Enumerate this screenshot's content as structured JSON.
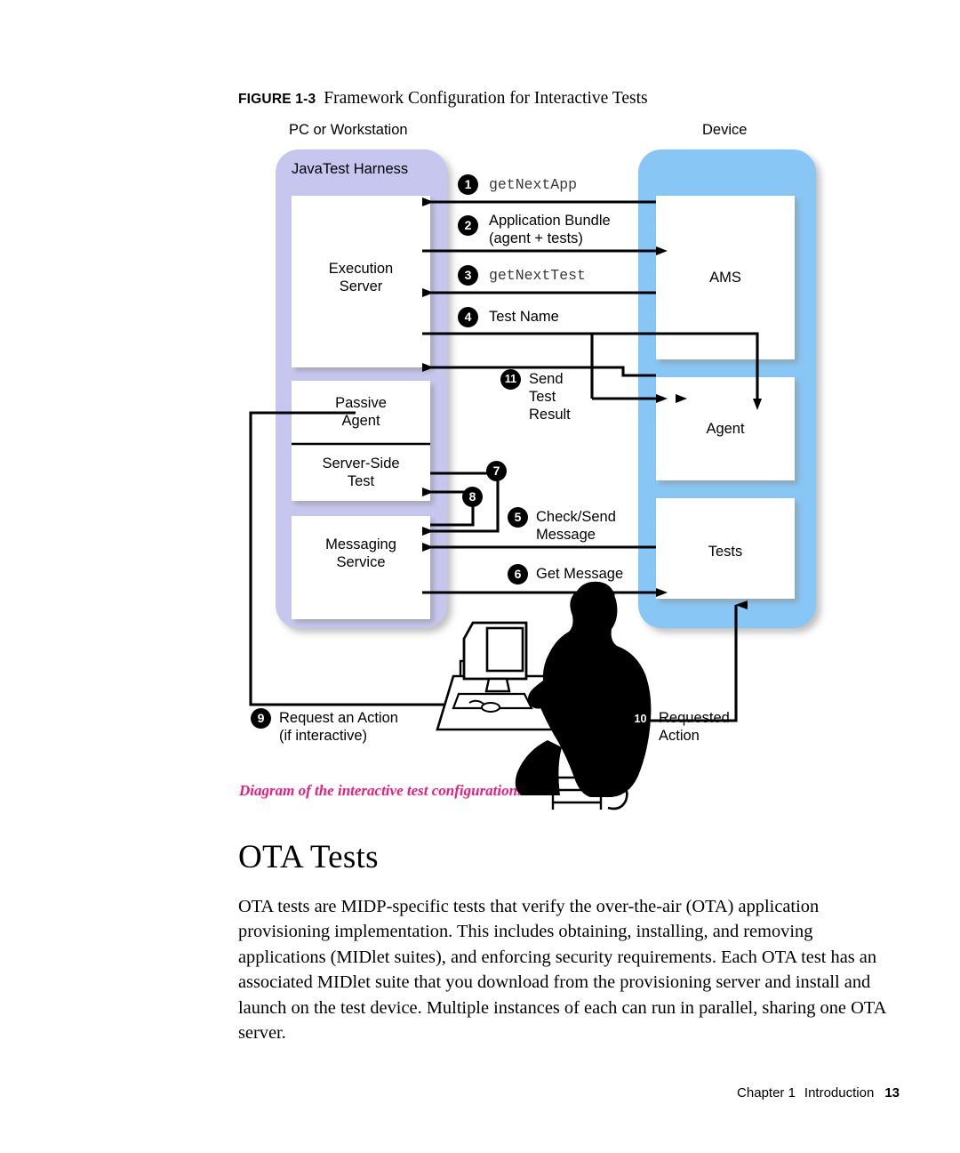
{
  "figure": {
    "label": "FIGURE 1-3",
    "title": "Framework Configuration for Interactive Tests",
    "caption": "Diagram of the interactive test configuration.",
    "caption_color": "#ec1c7d"
  },
  "diagram": {
    "left_container": {
      "outer_label": "PC or Workstation",
      "title": "JavaTest Harness",
      "fill_color": "#c6c6ef",
      "boxes": [
        {
          "id": "execution-server",
          "label_line1": "Execution",
          "label_line2": "Server"
        },
        {
          "id": "passive-agent",
          "label_line1": "Passive",
          "label_line2": "Agent"
        },
        {
          "id": "server-side-test",
          "label_line1": "Server-Side",
          "label_line2": "Test"
        },
        {
          "id": "messaging-service",
          "label_line1": "Messaging",
          "label_line2": "Service"
        }
      ]
    },
    "right_container": {
      "outer_label": "Device",
      "fill_color": "#87c6f5",
      "boxes": [
        {
          "id": "ams",
          "label": "AMS"
        },
        {
          "id": "agent",
          "label": "Agent"
        },
        {
          "id": "tests",
          "label": "Tests"
        }
      ]
    },
    "steps": [
      {
        "n": "1",
        "text_line1": "getNextApp",
        "text_line2": "",
        "mono": true
      },
      {
        "n": "2",
        "text_line1": "Application Bundle",
        "text_line2": "(agent + tests)",
        "mono": false
      },
      {
        "n": "3",
        "text_line1": "getNextTest",
        "text_line2": "",
        "mono": true
      },
      {
        "n": "4",
        "text_line1": "Test Name",
        "text_line2": "",
        "mono": false
      },
      {
        "n": "5",
        "text_line1": "Check/Send",
        "text_line2": "Message",
        "mono": false
      },
      {
        "n": "6",
        "text_line1": "Get Message",
        "text_line2": "",
        "mono": false
      },
      {
        "n": "7",
        "text_line1": "",
        "text_line2": "",
        "mono": false
      },
      {
        "n": "8",
        "text_line1": "",
        "text_line2": "",
        "mono": false
      },
      {
        "n": "9",
        "text_line1": "Request an Action",
        "text_line2": "(if interactive)",
        "mono": false
      },
      {
        "n": "10",
        "text_line1": "Requested",
        "text_line2": "Action",
        "mono": false
      },
      {
        "n": "11",
        "text_line1": "Send",
        "text_line2": "Test",
        "text_line3": "Result",
        "mono": false
      }
    ],
    "illustration": "person-at-computer-silhouette"
  },
  "content": {
    "heading": "OTA Tests",
    "paragraph": "OTA tests are MIDP-specific tests that verify the over-the-air (OTA) application provisioning implementation. This includes obtaining, installing, and removing applications (MIDlet suites), and enforcing security requirements. Each OTA test has an associated MIDlet suite that you download from the provisioning server and install and launch on the test device. Multiple instances of each can run in parallel, sharing one OTA server."
  },
  "footer": {
    "chapter": "Chapter 1",
    "section": "Introduction",
    "page_number": "13"
  }
}
